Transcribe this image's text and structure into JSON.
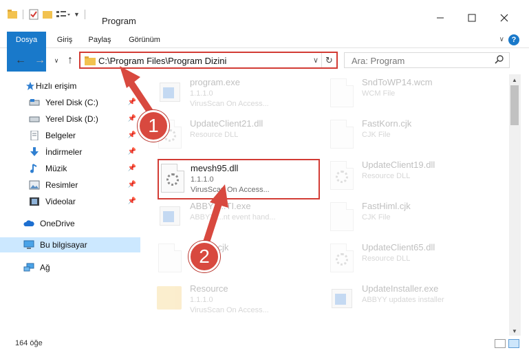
{
  "window": {
    "title": "Program"
  },
  "ribbon": {
    "tabs": [
      "Dosya",
      "Giriş",
      "Paylaş",
      "Görünüm"
    ]
  },
  "address": {
    "path": "C:\\Program Files\\Program Dizini",
    "search_placeholder": "Ara: Program"
  },
  "nav": {
    "quick_access": "Hızlı erişim",
    "items": [
      "Yerel Disk (C:)",
      "Yerel Disk (D:)",
      "Belgeler",
      "İndirmeler",
      "Müzik",
      "Resimler",
      "Videolar"
    ],
    "onedrive": "OneDrive",
    "this_pc": "Bu bilgisayar",
    "network": "Ağ"
  },
  "files": {
    "left": [
      {
        "name": "program.exe",
        "l2": "1.1.1.0",
        "l3": "VirusScan On Access..."
      },
      {
        "name": "UpdateClient21.dll",
        "l2": "Resource DLL",
        "l3": ""
      },
      {
        "name": "mevsh95.dll",
        "l2": "1.1.1.0",
        "l3": "VirusScan On Access..."
      },
      {
        "name": "ABBYY...TI.exe",
        "l2": "ABBYY ...nt event hand...",
        "l3": ""
      },
      {
        "name": "...Font.cjk",
        "l2": "",
        "l3": ""
      },
      {
        "name": "Resource",
        "l2": "1.1.1.0",
        "l3": "VirusScan On Access..."
      }
    ],
    "right": [
      {
        "name": "SndToWP14.wcm",
        "l2": "WCM File",
        "l3": ""
      },
      {
        "name": "FastKorn.cjk",
        "l2": "CJK File",
        "l3": ""
      },
      {
        "name": "UpdateClient19.dll",
        "l2": "Resource DLL",
        "l3": ""
      },
      {
        "name": "FastHiml.cjk",
        "l2": "CJK File",
        "l3": ""
      },
      {
        "name": "UpdateClient65.dll",
        "l2": "Resource DLL",
        "l3": ""
      },
      {
        "name": "UpdateInstaller.exe",
        "l2": "ABBYY updates installer",
        "l3": ""
      }
    ]
  },
  "status": {
    "count": "164 öğe"
  },
  "annotations": {
    "step1": "1",
    "step2": "2"
  },
  "colors": {
    "accent": "#1979ca",
    "highlight": "#d23b34",
    "selected": "#cce8ff"
  }
}
